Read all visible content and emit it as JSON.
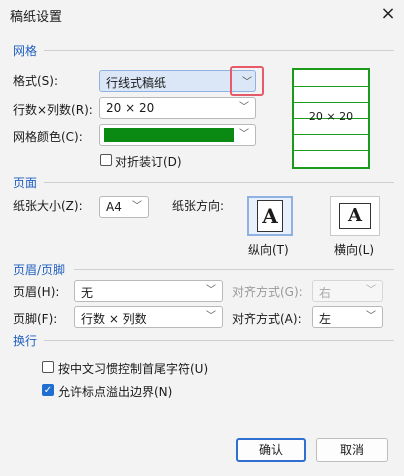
{
  "dialog": {
    "title": "稿纸设置"
  },
  "grid_section": {
    "title": "网格",
    "style_label": "格式(S):",
    "style_value": "行线式稿纸",
    "rows_cols_label": "行数×列数(R):",
    "rows_cols_value": "20 × 20",
    "color_label": "网格颜色(C):",
    "color_value": "#0a8a12",
    "fold_label": "对折装订(D)",
    "fold_checked": false,
    "preview_text": "20 × 20"
  },
  "page_section": {
    "title": "页面",
    "size_label": "纸张大小(Z):",
    "size_value": "A4",
    "orientation_label": "纸张方向:",
    "portrait_label": "纵向(T)",
    "landscape_label": "横向(L)",
    "orientation_glyph": "A"
  },
  "header_footer_section": {
    "title": "页眉/页脚",
    "header_label": "页眉(H):",
    "header_value": "无",
    "header_align_label": "对齐方式(G):",
    "header_align_value": "右",
    "footer_label": "页脚(F):",
    "footer_value": "行数 × 列数",
    "footer_align_label": "对齐方式(A):",
    "footer_align_value": "左"
  },
  "wrap_section": {
    "title": "换行",
    "option1_label": "按中文习惯控制首尾字符(U)",
    "option1_checked": false,
    "option2_label": "允许标点溢出边界(N)",
    "option2_checked": true
  },
  "buttons": {
    "ok": "确认",
    "cancel": "取消"
  },
  "icons": {
    "close": "×",
    "dropdown": "﹀",
    "check": "✓"
  }
}
